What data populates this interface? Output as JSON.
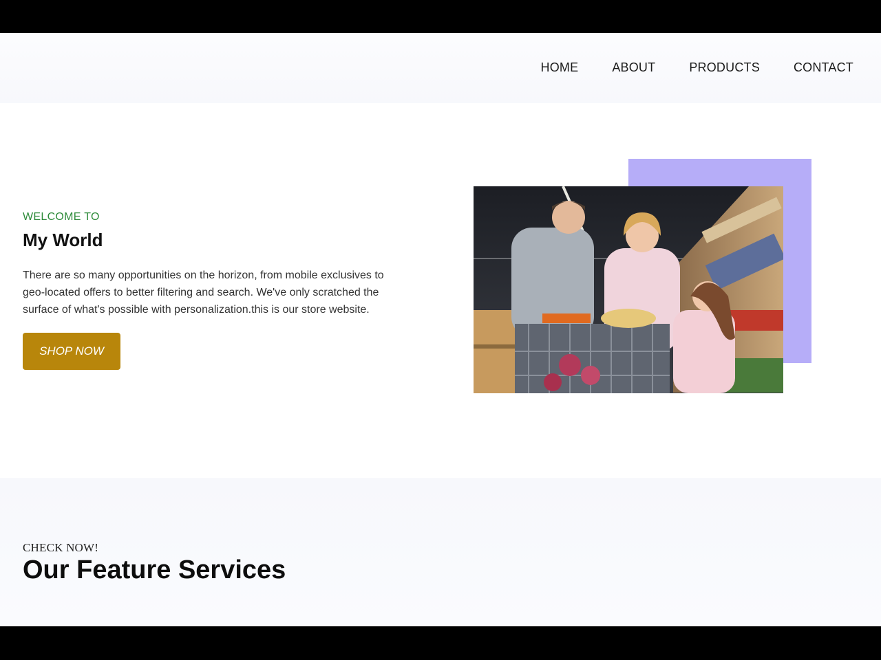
{
  "nav": {
    "items": [
      {
        "label": "HOME"
      },
      {
        "label": "ABOUT"
      },
      {
        "label": "PRODUCTS"
      },
      {
        "label": "CONTACT"
      }
    ]
  },
  "hero": {
    "eyebrow": "WELCOME TO",
    "title": "My World",
    "text": "There are so many opportunities on the horizon, from mobile exclusives to geo-located offers to better filtering and search. We've only scratched the surface of what's possible with personalization.this is our store website.",
    "cta_label": "SHOP NOW"
  },
  "services": {
    "eyebrow": "CHECK NOW!",
    "title": "Our Feature Services"
  },
  "colors": {
    "accent_green": "#2e8b3a",
    "cta_gold": "#b8860b",
    "accent_lavender": "#b6adf8"
  }
}
